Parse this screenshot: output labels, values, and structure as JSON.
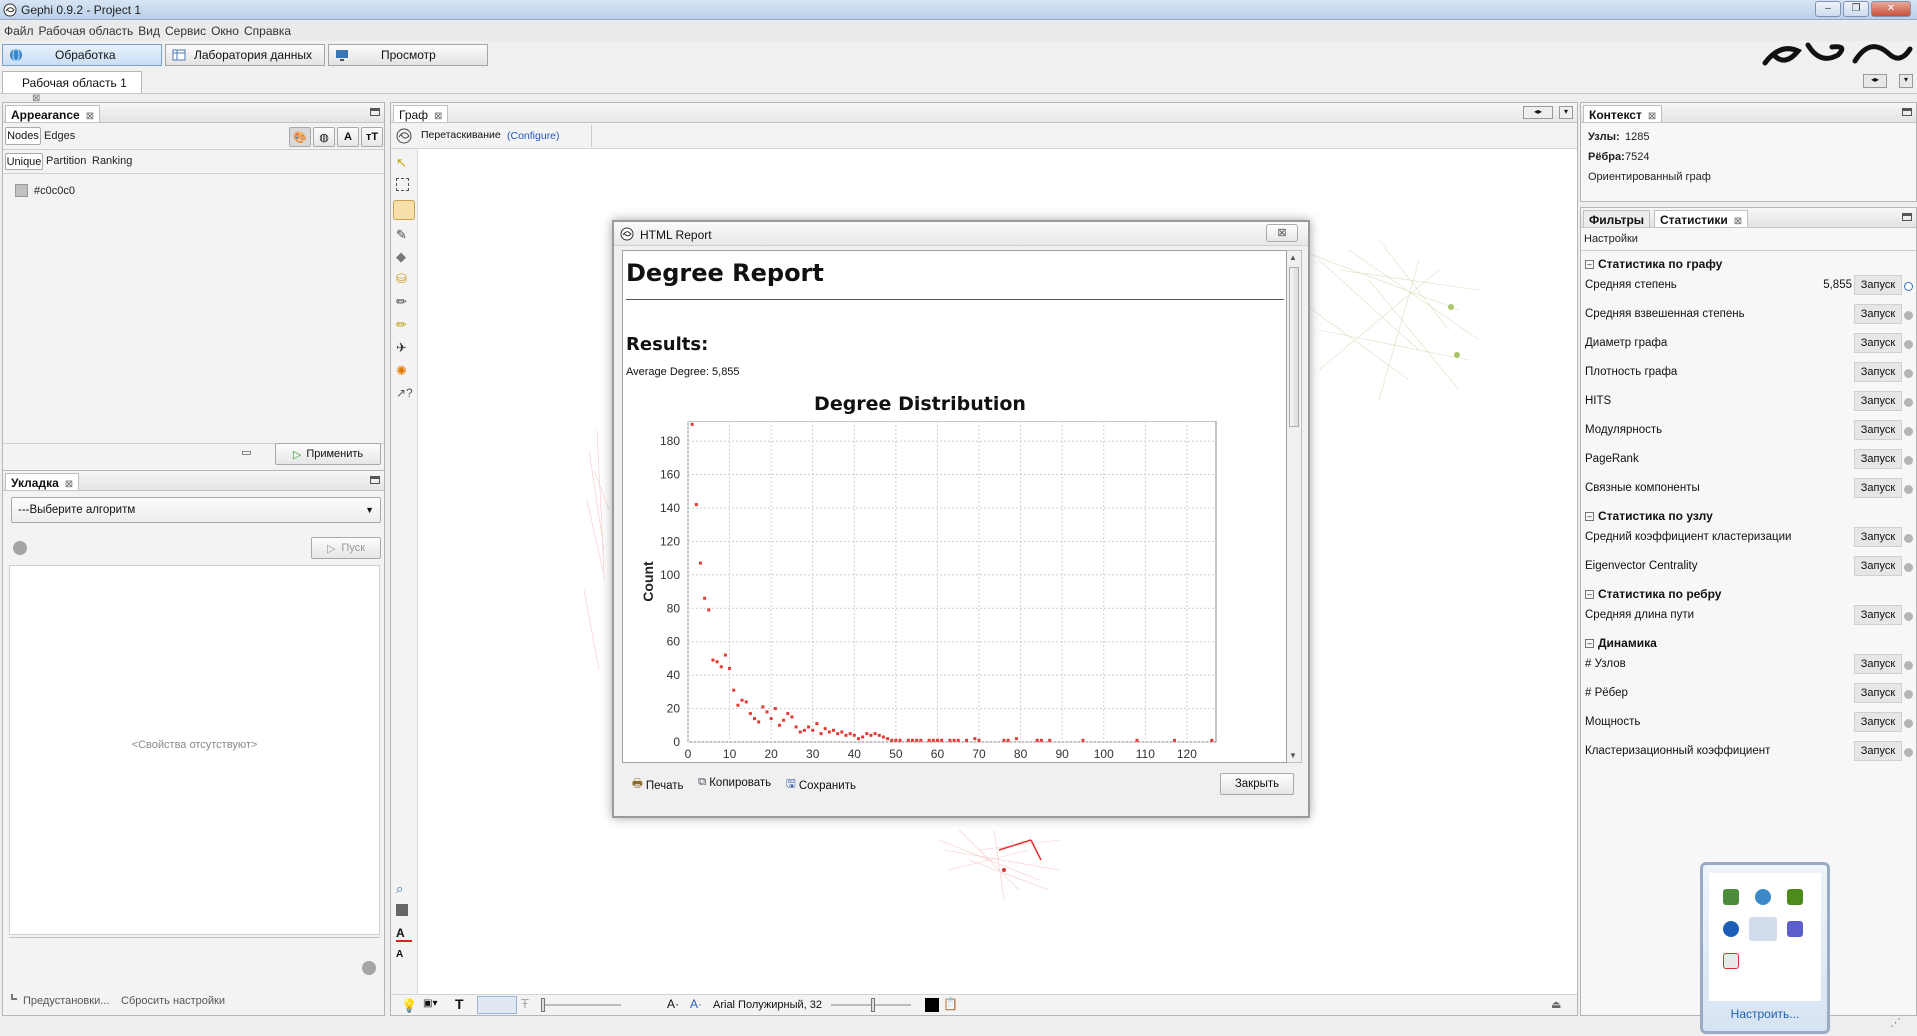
{
  "window": {
    "title": "Gephi 0.9.2 - Project 1",
    "controls": [
      "–",
      "❐",
      "✕"
    ]
  },
  "menu": [
    "Файл",
    "Рабочая область",
    "Вид",
    "Сервис",
    "Окно",
    "Справка"
  ],
  "modes": [
    "Обработка",
    "Лаборатория данных",
    "Просмотр"
  ],
  "workspace_tab": "Рабочая область 1",
  "appearance": {
    "title": "Appearance",
    "tab_nodes": "Nodes",
    "tab_edges": "Edges",
    "sub_unique": "Unique",
    "sub_partition": "Partition",
    "sub_ranking": "Ranking",
    "color_value": "#c0c0c0",
    "apply": "Применить"
  },
  "layout_panel": {
    "title": "Укладка",
    "select_placeholder": "---Выберите алгоритм",
    "run": "Пуск",
    "empty_props": "<Свойства отсутствуют>",
    "presets": "Предустановки...",
    "reset": "Сбросить настройки"
  },
  "graph": {
    "tab": "Граф",
    "mode_label": "Перетаскивание",
    "configure": "(Configure)",
    "font_label": "Arial Полужирный, 32"
  },
  "context": {
    "title": "Контекст",
    "nodes_label": "Узлы:",
    "nodes_value": "1285",
    "edges_label": "Рёбра:",
    "edges_value": "7524",
    "graph_type": "Ориентированный граф"
  },
  "stats_panel": {
    "tab_filters": "Фильтры",
    "tab_stats": "Статистики",
    "settings": "Настройки",
    "run_label": "Запуск",
    "section_graph": "Статистика по графу",
    "graph_rows": [
      {
        "label": "Средняя степень",
        "value": "5,855"
      },
      {
        "label": "Средняя взвешенная степень",
        "value": ""
      },
      {
        "label": "Диаметр графа",
        "value": ""
      },
      {
        "label": "Плотность графа",
        "value": ""
      },
      {
        "label": "HITS",
        "value": ""
      },
      {
        "label": "Модулярность",
        "value": ""
      },
      {
        "label": "PageRank",
        "value": ""
      },
      {
        "label": "Связные компоненты",
        "value": ""
      }
    ],
    "section_node": "Статистика по узлу",
    "node_rows": [
      {
        "label": "Средний коэффициент кластеризации",
        "value": ""
      },
      {
        "label": "Eigenvector Centrality",
        "value": ""
      }
    ],
    "section_edge": "Статистика по ребру",
    "edge_rows": [
      {
        "label": "Средняя длина пути",
        "value": ""
      }
    ],
    "section_dynamic": "Динамика",
    "dynamic_rows": [
      {
        "label": "# Узлов",
        "value": ""
      },
      {
        "label": "# Рёбер",
        "value": ""
      },
      {
        "label": "Мощность",
        "value": ""
      },
      {
        "label": "Кластеризационный коэффициент",
        "value": ""
      }
    ]
  },
  "dialog": {
    "title": "HTML Report",
    "heading": "Degree Report",
    "results": "Results:",
    "avg_degree": "Average Degree: 5,855",
    "print": "Печать",
    "copy": "Копировать",
    "save": "Сохранить",
    "close": "Закрыть"
  },
  "tray": {
    "customize": "Настроить..."
  },
  "chart_data": {
    "type": "scatter",
    "title": "Degree Distribution",
    "xlabel": "",
    "ylabel": "Count",
    "xlim": [
      0,
      127
    ],
    "ylim": [
      0,
      192
    ],
    "xticks": [
      0,
      10,
      20,
      30,
      40,
      50,
      60,
      70,
      80,
      90,
      100,
      110,
      120
    ],
    "yticks": [
      0,
      20,
      40,
      60,
      80,
      100,
      120,
      140,
      160,
      180
    ],
    "color": "#e53935",
    "points": [
      [
        1,
        190
      ],
      [
        2,
        142
      ],
      [
        3,
        107
      ],
      [
        4,
        86
      ],
      [
        5,
        79
      ],
      [
        6,
        49
      ],
      [
        7,
        48
      ],
      [
        8,
        45
      ],
      [
        9,
        52
      ],
      [
        10,
        44
      ],
      [
        11,
        31
      ],
      [
        12,
        22
      ],
      [
        13,
        25
      ],
      [
        14,
        24
      ],
      [
        15,
        17
      ],
      [
        16,
        14
      ],
      [
        17,
        12
      ],
      [
        18,
        21
      ],
      [
        19,
        18
      ],
      [
        20,
        14
      ],
      [
        21,
        20
      ],
      [
        22,
        10
      ],
      [
        23,
        13
      ],
      [
        24,
        17
      ],
      [
        25,
        15
      ],
      [
        26,
        9
      ],
      [
        27,
        6
      ],
      [
        28,
        7
      ],
      [
        29,
        9
      ],
      [
        30,
        7
      ],
      [
        31,
        11
      ],
      [
        32,
        5
      ],
      [
        33,
        8
      ],
      [
        34,
        6
      ],
      [
        35,
        7
      ],
      [
        36,
        5
      ],
      [
        37,
        6
      ],
      [
        38,
        4
      ],
      [
        39,
        5
      ],
      [
        40,
        4
      ],
      [
        41,
        2
      ],
      [
        42,
        3
      ],
      [
        43,
        5
      ],
      [
        44,
        4
      ],
      [
        45,
        5
      ],
      [
        46,
        4
      ],
      [
        47,
        3
      ],
      [
        48,
        2
      ],
      [
        49,
        1
      ],
      [
        50,
        1
      ],
      [
        51,
        1
      ],
      [
        53,
        1
      ],
      [
        54,
        1
      ],
      [
        55,
        1
      ],
      [
        56,
        1
      ],
      [
        58,
        1
      ],
      [
        59,
        1
      ],
      [
        60,
        1
      ],
      [
        61,
        1
      ],
      [
        63,
        1
      ],
      [
        64,
        1
      ],
      [
        65,
        1
      ],
      [
        67,
        1
      ],
      [
        69,
        2
      ],
      [
        70,
        1
      ],
      [
        76,
        1
      ],
      [
        77,
        1
      ],
      [
        79,
        2
      ],
      [
        84,
        1
      ],
      [
        85,
        1
      ],
      [
        87,
        1
      ],
      [
        95,
        1
      ],
      [
        108,
        1
      ],
      [
        117,
        1
      ],
      [
        126,
        1
      ]
    ]
  }
}
